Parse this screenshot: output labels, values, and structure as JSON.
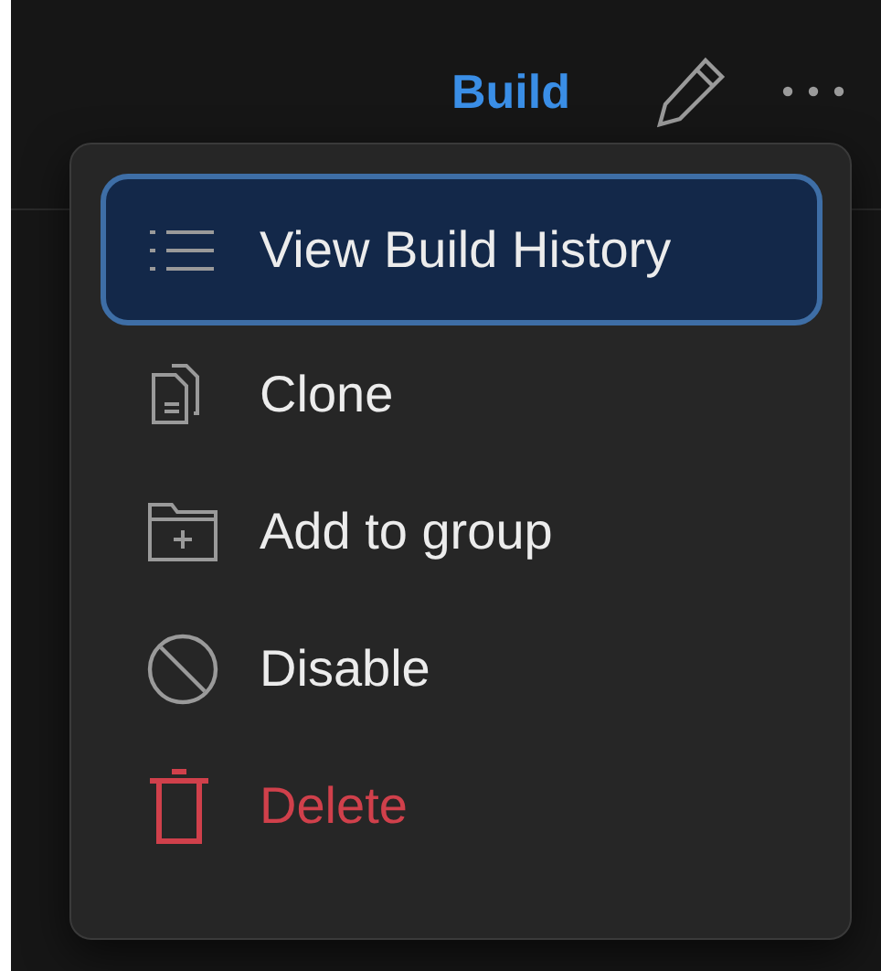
{
  "toolbar": {
    "build_label": "Build"
  },
  "menu": {
    "items": [
      {
        "label": "View Build History",
        "kind": "action",
        "selected": true
      },
      {
        "label": "Clone",
        "kind": "action",
        "selected": false
      },
      {
        "label": "Add to group",
        "kind": "action",
        "selected": false
      },
      {
        "label": "Disable",
        "kind": "action",
        "selected": false
      },
      {
        "label": "Delete",
        "kind": "danger",
        "selected": false
      }
    ]
  }
}
